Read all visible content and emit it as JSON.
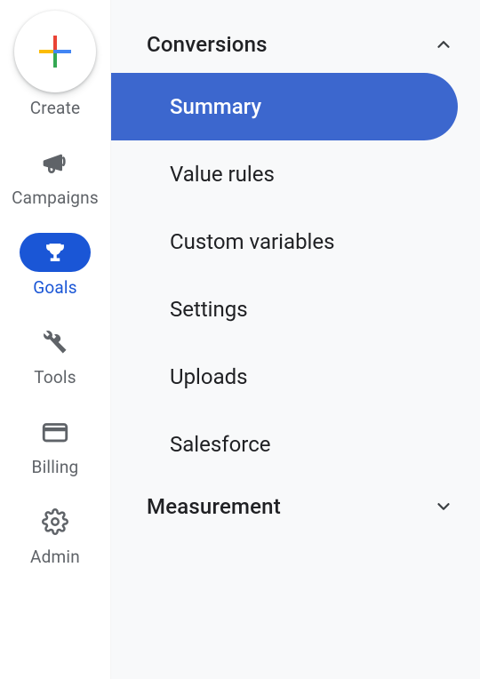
{
  "leftRail": {
    "createLabel": "Create",
    "items": [
      {
        "label": "Campaigns"
      },
      {
        "label": "Goals"
      },
      {
        "label": "Tools"
      },
      {
        "label": "Billing"
      },
      {
        "label": "Admin"
      }
    ]
  },
  "panel": {
    "groups": [
      {
        "title": "Conversions",
        "expanded": true,
        "items": [
          {
            "label": "Summary",
            "selected": true
          },
          {
            "label": "Value rules"
          },
          {
            "label": "Custom variables"
          },
          {
            "label": "Settings"
          },
          {
            "label": "Uploads"
          },
          {
            "label": "Salesforce"
          }
        ]
      },
      {
        "title": "Measurement",
        "expanded": false,
        "items": []
      }
    ]
  }
}
